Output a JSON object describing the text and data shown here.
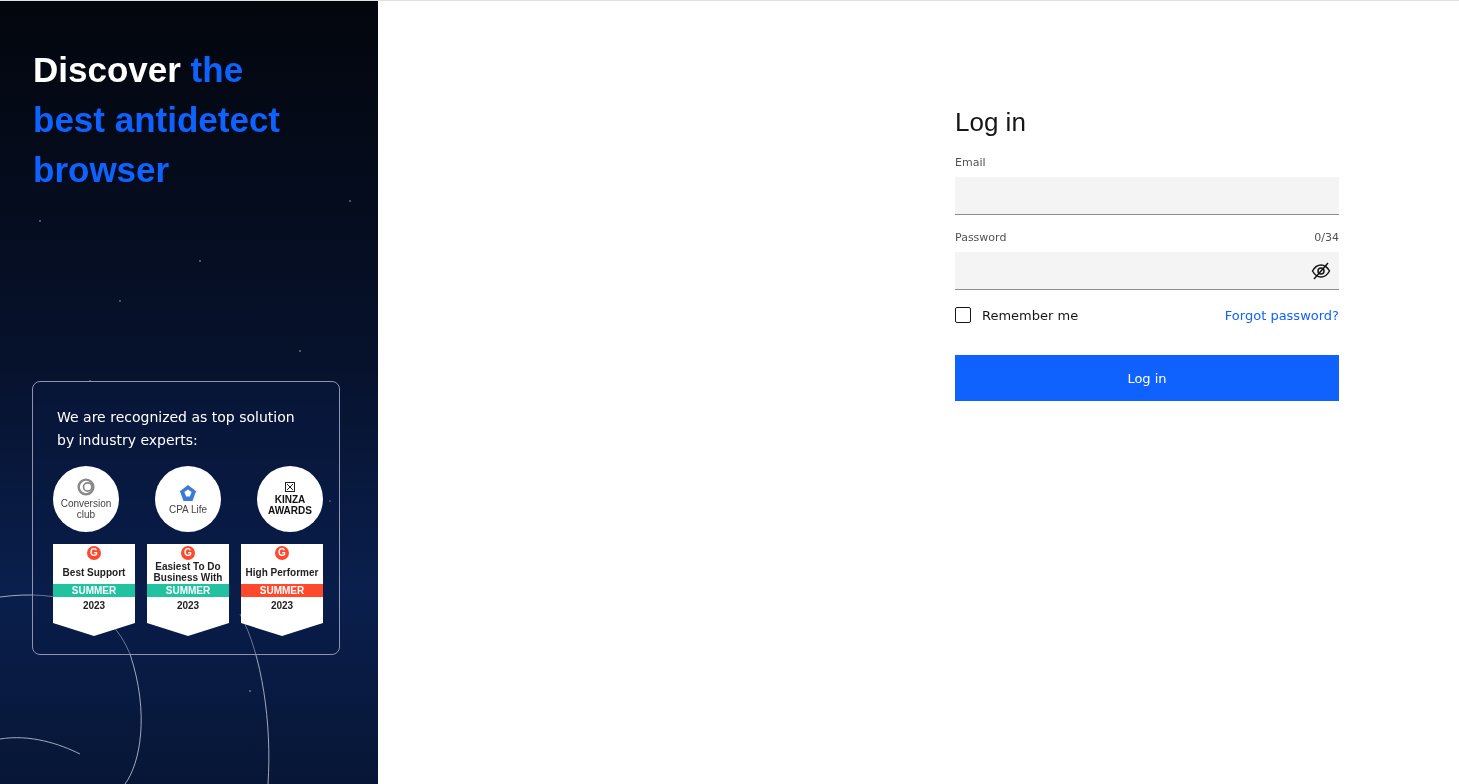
{
  "promo": {
    "headline_lead": "Discover",
    "headline_accent": "the best antidetect browser",
    "recognition": {
      "text": "We are recognized as top solution by industry experts:",
      "logos": [
        {
          "kind": "conversion",
          "lines": [
            "Conversion",
            "club"
          ]
        },
        {
          "kind": "cpa",
          "lines": [
            "CPA Life"
          ]
        },
        {
          "kind": "kinza",
          "lines": [
            "KINZA",
            "AWARDS"
          ]
        }
      ],
      "badges": [
        {
          "mark": "G",
          "title": "Best Support",
          "season": "SUMMER",
          "year": "2023",
          "color": "#21c2a0"
        },
        {
          "mark": "G",
          "title": "Easiest To Do Business With",
          "season": "SUMMER",
          "year": "2023",
          "color": "#21c2a0"
        },
        {
          "mark": "G",
          "title": "High Performer",
          "season": "SUMMER",
          "year": "2023",
          "color": "#ff492c"
        }
      ]
    }
  },
  "form": {
    "title": "Log in",
    "email": {
      "label": "Email"
    },
    "password": {
      "label": "Password",
      "counter": "0/34"
    },
    "remember": {
      "label": "Remember me",
      "checked": false
    },
    "forgot": "Forgot password?",
    "submit": "Log in"
  }
}
